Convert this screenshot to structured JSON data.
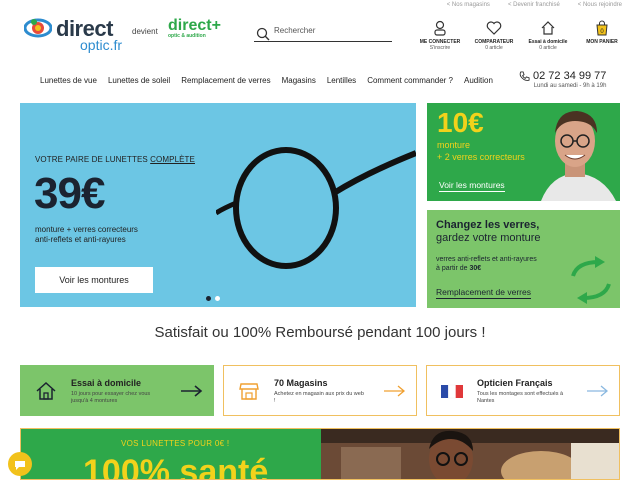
{
  "top_links": [
    "< Nos magasins",
    "< Devenir franchisé",
    "< Nous rejoindre"
  ],
  "brand": {
    "old_name_top": "direct",
    "old_name_bottom": "optic.fr",
    "devient": "devient",
    "new_name": "direct+",
    "new_tagline": "optic & audition"
  },
  "search": {
    "placeholder": "Rechercher",
    "value": ""
  },
  "header_actions": [
    {
      "label": "ME CONNECTER",
      "sub": "S'inscrire",
      "icon": "user-icon"
    },
    {
      "label": "COMPARATEUR",
      "sub": "0 article",
      "icon": "heart-icon"
    },
    {
      "label": "Essai à domicile",
      "sub": "0 article",
      "icon": "home-icon"
    },
    {
      "label": "MON PANIER",
      "sub": "",
      "icon": "cart-icon",
      "count": "0"
    }
  ],
  "nav": [
    "Lunettes de vue",
    "Lunettes de soleil",
    "Remplacement de verres",
    "Magasins",
    "Lentilles",
    "Comment commander ?",
    "Audition"
  ],
  "phone": {
    "number": "02 72 34 99 77",
    "hours": "Lundi au samedi - 9h à 19h"
  },
  "hero": {
    "kicker_prefix": "VOTRE PAIRE DE LUNETTES",
    "kicker_link": "COMPLÈTE",
    "price": "39€",
    "line1": "monture + verres correcteurs",
    "line2": "anti-reflets et anti-rayures",
    "button": "Voir les montures",
    "slides": 2,
    "active_slide": 1
  },
  "promo_1": {
    "price": "10€",
    "line1": "monture",
    "line2": "+ 2 verres correcteurs",
    "link": "Voir les montures"
  },
  "promo_2": {
    "title_bold": "Changez les verres,",
    "title_rest": "gardez votre monture",
    "desc1": "verres anti-reflets et anti-rayures",
    "desc2_prefix": "à partir de ",
    "desc2_price": "30€",
    "link": "Remplacement de verres"
  },
  "guarantee": "Satisfait ou 100% Remboursé pendant 100 jours !",
  "cards": [
    {
      "title": "Essai à domicile",
      "desc": "10 jours pour essayer chez vous jusqu'à 4 montures",
      "icon": "home-icon"
    },
    {
      "title": "70 Magasins",
      "desc": "Achetez en magasin aux prix du web !",
      "icon": "store-icon"
    },
    {
      "title": "Opticien Français",
      "desc": "Tous les montages sont effectués à Nantes",
      "icon": "french-flag-icon"
    }
  ],
  "banner": {
    "kicker": "VOS LUNETTES POUR 0€ !",
    "big": "100% santé"
  },
  "colors": {
    "green": "#2ea84a",
    "light_green": "#7cc56a",
    "yellow": "#f2d21b",
    "sky_blue": "#6cc6e4",
    "navy": "#1b2330"
  }
}
